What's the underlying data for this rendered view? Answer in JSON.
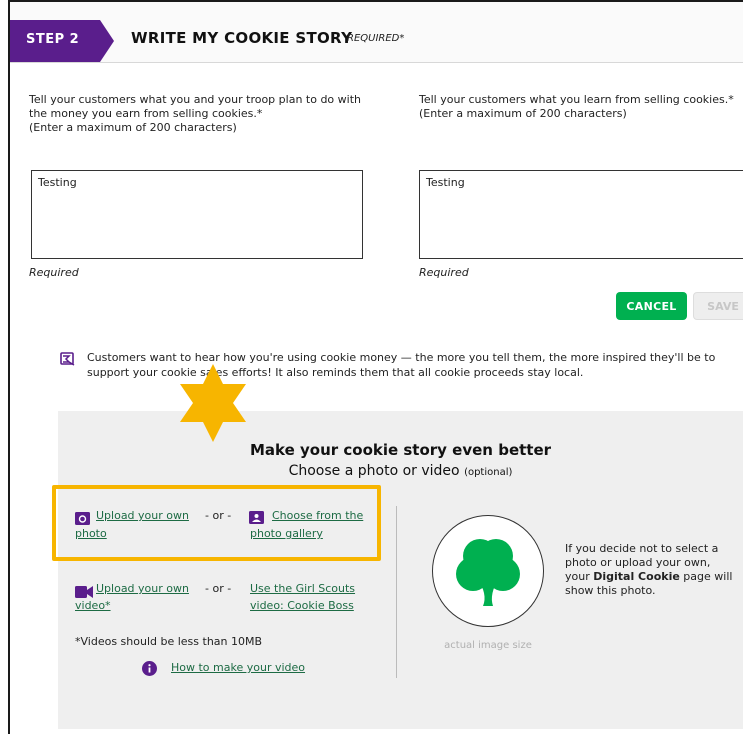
{
  "header": {
    "step": "STEP 2",
    "title": "WRITE MY COOKIE STORY",
    "required": "REQUIRED*"
  },
  "left_prompt": {
    "line1": "Tell your customers what you and your troop plan to do with",
    "line2": "the money you earn from selling cookies.*",
    "line3": "(Enter a maximum of 200 characters)",
    "value": "Testing",
    "required_note": "Required"
  },
  "right_prompt": {
    "line1": "Tell your customers what you learn from selling cookies.*",
    "line2": "(Enter a maximum of 200 characters)",
    "value": "Testing",
    "required_note": "Required"
  },
  "buttons": {
    "cancel": "CANCEL",
    "save": "SAVE"
  },
  "info": {
    "line1": "Customers want to hear how you're using cookie money — the more you tell them, the more inspired they'll be to",
    "line2": "support your cookie sales efforts! It also reminds them that all cookie proceeds stay local."
  },
  "panel": {
    "title": "Make your cookie story even better",
    "subtitle": "Choose a photo or video",
    "optional": "(optional)",
    "upload_photo_l1": "Upload your own",
    "upload_photo_l2": "photo",
    "or": "- or -",
    "gallery_l1": "Choose from the",
    "gallery_l2": "photo gallery",
    "upload_video_l1": "Upload your own",
    "upload_video_l2": "video*",
    "gs_video_l1": "Use the Girl Scouts",
    "gs_video_l2": "video: Cookie Boss",
    "video_limit": "*Videos should be less than 10MB",
    "how_to": "How to make your video",
    "caption": "actual image size",
    "default_note_1": "If you decide not to select a",
    "default_note_2": "photo or upload your own,",
    "default_note_3_pre": "your ",
    "default_note_3_bold": "Digital Cookie",
    "default_note_3_post": " page will",
    "default_note_4": "show this photo."
  },
  "colors": {
    "brand_purple": "#5a1e8c",
    "green": "#00b050",
    "link_green": "#1d6b44",
    "highlight": "#f7b500"
  }
}
